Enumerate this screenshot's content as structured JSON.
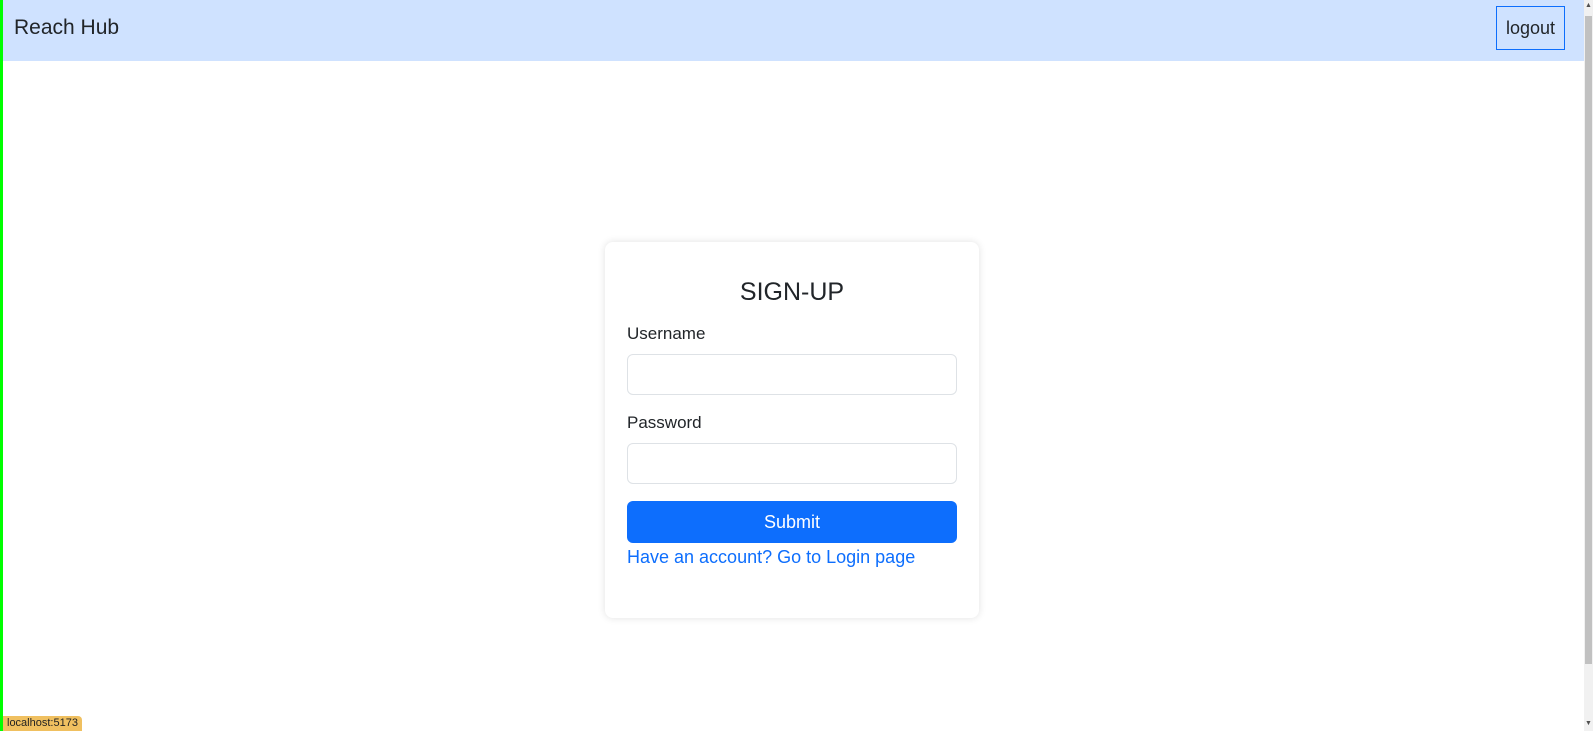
{
  "navbar": {
    "brand": "Reach Hub",
    "logout_label": "logout"
  },
  "form": {
    "title": "SIGN-UP",
    "username_label": "Username",
    "username_value": "",
    "password_label": "Password",
    "password_value": "",
    "submit_label": "Submit",
    "login_link": "Have an account? Go to Login page"
  },
  "status_bar": {
    "url": "localhost:5173"
  },
  "colors": {
    "navbar_bg": "#cfe2ff",
    "primary": "#0d6efd"
  }
}
